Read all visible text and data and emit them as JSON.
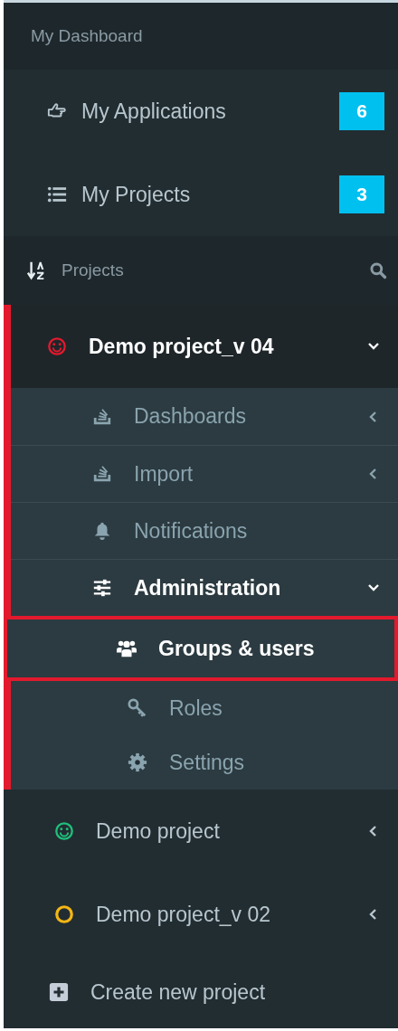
{
  "header": {
    "title": "My Dashboard"
  },
  "dashboard_items": [
    {
      "label": "My Applications",
      "badge": "6",
      "kind": "hand"
    },
    {
      "label": "My Projects",
      "badge": "3",
      "kind": "list"
    }
  ],
  "projects_header": {
    "title": "Projects"
  },
  "projects": [
    {
      "name": "Demo project_v 04",
      "kind": "smile",
      "color": "#e3192d",
      "expanded": true,
      "children": [
        {
          "label": "Dashboards",
          "kind": "stack",
          "expanded": false
        },
        {
          "label": "Import",
          "kind": "stack",
          "expanded": false
        },
        {
          "label": "Notifications",
          "kind": "bell"
        },
        {
          "label": "Administration",
          "kind": "sliders",
          "expanded": true,
          "children": [
            {
              "label": "Groups & users",
              "kind": "users",
              "selected": true
            },
            {
              "label": "Roles",
              "kind": "key",
              "selected": false
            },
            {
              "label": "Settings",
              "kind": "gear",
              "selected": false
            }
          ]
        }
      ]
    },
    {
      "name": "Demo project",
      "kind": "smile",
      "color": "#1fbf7a",
      "expanded": false
    },
    {
      "name": "Demo project_v 02",
      "kind": "ring",
      "color": "#f3b614",
      "expanded": false
    }
  ],
  "create_project": {
    "label": "Create new project"
  }
}
